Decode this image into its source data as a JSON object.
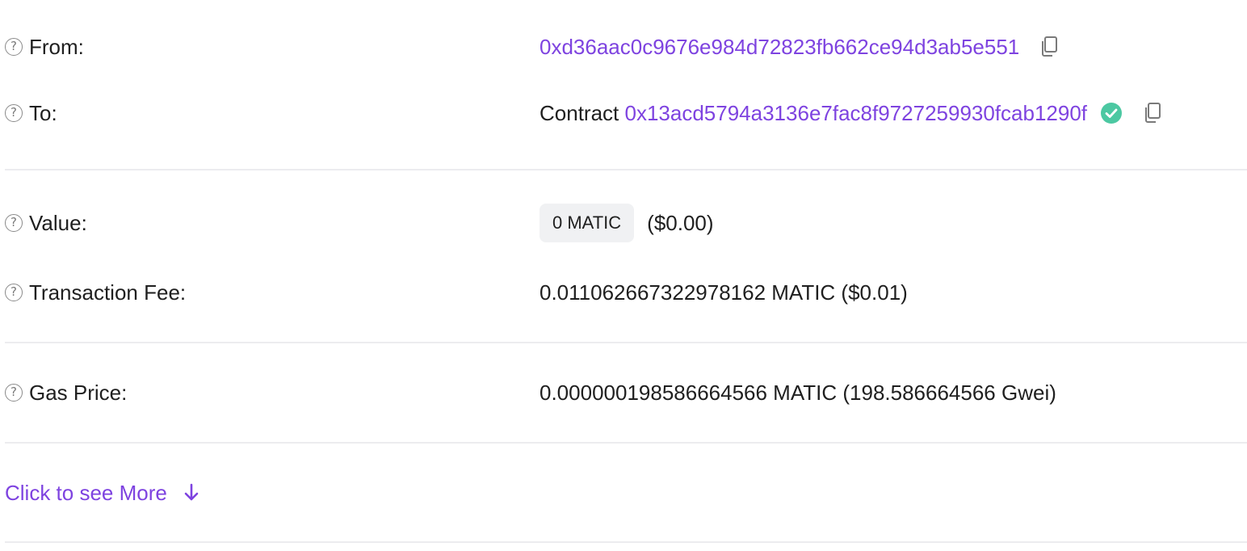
{
  "from": {
    "label": "From:",
    "address": "0xd36aac0c9676e984d72823fb662ce94d3ab5e551"
  },
  "to": {
    "label": "To:",
    "prefix": "Contract",
    "address": "0x13acd5794a3136e7fac8f9727259930fcab1290f"
  },
  "value": {
    "label": "Value:",
    "amount_badge": "0 MATIC",
    "usd": "($0.00)"
  },
  "fee": {
    "label": "Transaction Fee:",
    "text": "0.011062667322978162 MATIC ($0.01)"
  },
  "gas": {
    "label": "Gas Price:",
    "text": "0.000000198586664566 MATIC (198.586664566 Gwei)"
  },
  "more": {
    "label": "Click to see More"
  },
  "icons": {
    "help": "question-circle-icon",
    "copy": "copy-icon",
    "verified": "check-circle-icon",
    "arrow": "arrow-down-icon"
  },
  "colors": {
    "link": "#7e43e0",
    "verified": "#4cc8a2",
    "divider": "#ececef",
    "badge_bg": "#f0f1f3"
  }
}
